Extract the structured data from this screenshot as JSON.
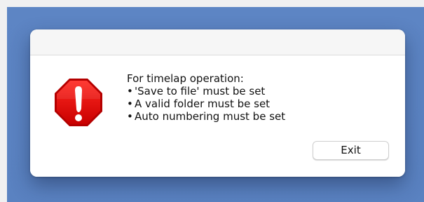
{
  "dialog": {
    "icon": "error-stop-icon",
    "message": {
      "heading": "For timelap operation:",
      "bullets": [
        "'Save to file' must be set",
        "A valid folder must be set",
        "Auto numbering must be set"
      ]
    },
    "button": {
      "label": "Exit"
    }
  },
  "colors": {
    "desktop_background": "#5d85c4",
    "dialog_background": "#ffffff",
    "alert_red": "#d90000"
  }
}
